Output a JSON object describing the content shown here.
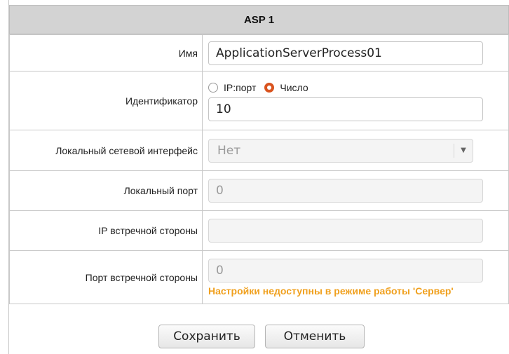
{
  "section": {
    "title": "ASP 1"
  },
  "fields": {
    "name": {
      "label": "Имя",
      "value": "ApplicationServerProcess01"
    },
    "identifier": {
      "label": "Идентификатор",
      "options": [
        "IP:порт",
        "Число"
      ],
      "selected": "Число",
      "value": "10"
    },
    "local_interface": {
      "label": "Локальный сетевой интерфейс",
      "value": "Нет"
    },
    "local_port": {
      "label": "Локальный порт",
      "value": "0"
    },
    "remote_ip": {
      "label": "IP встречной стороны",
      "value": ""
    },
    "remote_port": {
      "label": "Порт встречной стороны",
      "value": "0",
      "warning": "Настройки недоступны в режиме работы 'Сервер'"
    }
  },
  "buttons": {
    "save": "Сохранить",
    "cancel": "Отменить"
  },
  "colors": {
    "header_bg": "#d3d3d3",
    "radio_selected": "#d9531e",
    "warning_text": "#f0a01e"
  }
}
